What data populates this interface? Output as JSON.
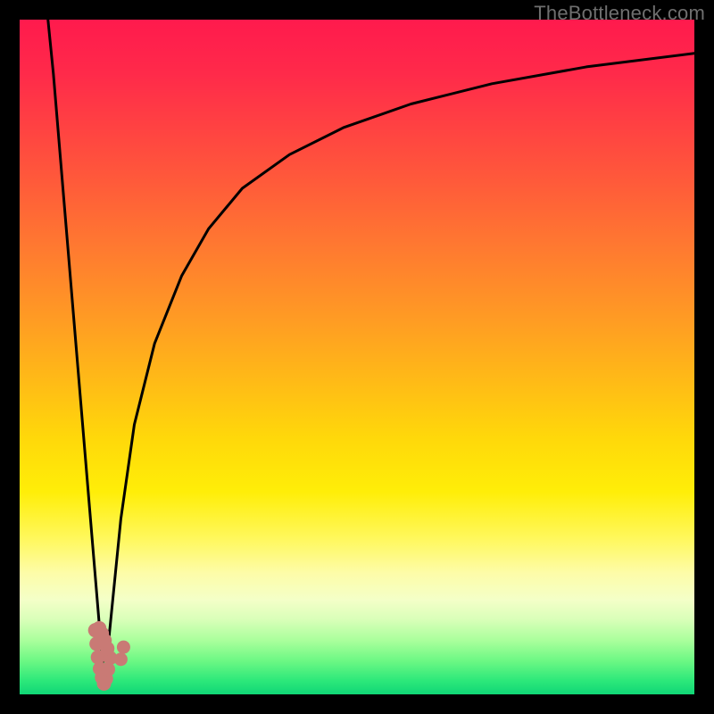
{
  "watermark": "TheBottleneck.com",
  "chart_data": {
    "type": "line",
    "title": "",
    "xlabel": "",
    "ylabel": "",
    "xlim": [
      0,
      100
    ],
    "ylim": [
      0,
      100
    ],
    "grid": false,
    "series": [
      {
        "name": "left-branch",
        "x": [
          4.2,
          5,
          6,
          7,
          8,
          9,
          10,
          11,
          12,
          12.6
        ],
        "values": [
          100,
          92,
          80,
          68,
          56,
          44,
          32,
          20,
          8,
          1.5
        ]
      },
      {
        "name": "right-branch",
        "x": [
          12.6,
          13,
          14,
          15,
          17,
          20,
          24,
          28,
          33,
          40,
          48,
          58,
          70,
          84,
          100
        ],
        "values": [
          1.5,
          6,
          16,
          26,
          40,
          52,
          62,
          69,
          75,
          80,
          84,
          87.5,
          90.5,
          93,
          95
        ]
      }
    ],
    "markers": [
      {
        "name": "v-trough",
        "x": [
          11.2,
          11.4,
          11.6,
          11.9,
          12.2,
          12.5,
          12.8,
          13.1,
          13.4,
          13.0,
          12.6,
          12.2,
          11.8
        ],
        "y": [
          9.5,
          7.5,
          5.5,
          3.8,
          2.5,
          1.6,
          2.3,
          3.7,
          5.4,
          6.8,
          8.0,
          9.0,
          9.8
        ],
        "color": "#c97a75",
        "size": 16
      },
      {
        "name": "right-dots",
        "x": [
          15.0,
          15.4
        ],
        "y": [
          5.2,
          7.0
        ],
        "color": "#c97a75",
        "size": 15
      }
    ],
    "background_gradient": {
      "stops": [
        {
          "pos": 0.0,
          "color": "#ff1a4d"
        },
        {
          "pos": 0.5,
          "color": "#ffbc16"
        },
        {
          "pos": 0.8,
          "color": "#fdfca8"
        },
        {
          "pos": 1.0,
          "color": "#10d676"
        }
      ]
    }
  }
}
